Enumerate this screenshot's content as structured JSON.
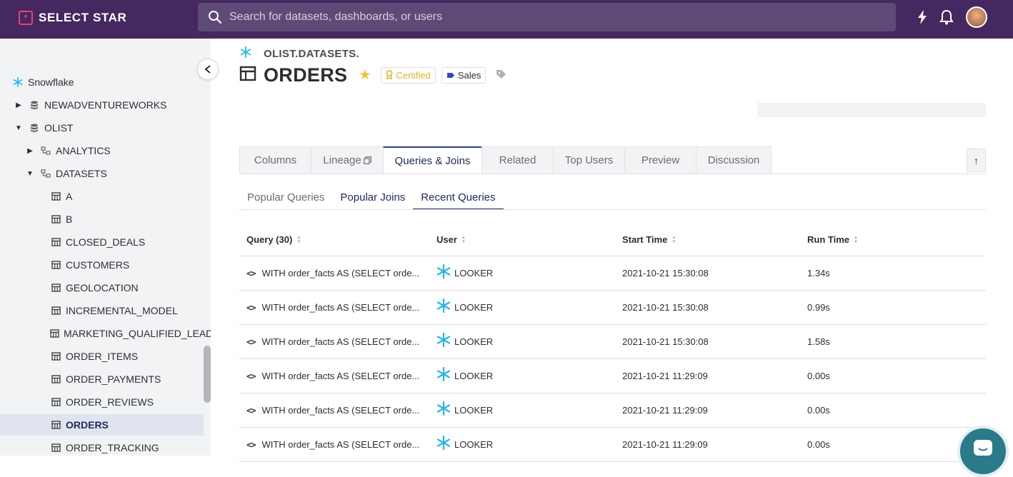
{
  "app": {
    "name": "SELECT STAR",
    "logo_mark": "*"
  },
  "search": {
    "placeholder": "Search for datasets, dashboards, or users",
    "value": ""
  },
  "top_icons": [
    "lightning-icon",
    "bell-icon",
    "user-avatar"
  ],
  "sidebar": {
    "items": [
      {
        "label": "Snowflake",
        "icon": "snowflake-icon",
        "level": 0,
        "caret": ""
      },
      {
        "label": "NEWADVENTUREWORKS",
        "icon": "database-icon",
        "level": 1,
        "caret": "right"
      },
      {
        "label": "OLIST",
        "icon": "database-icon",
        "level": 1,
        "caret": "down"
      },
      {
        "label": "ANALYTICS",
        "icon": "schema-icon",
        "level": 2,
        "caret": "right"
      },
      {
        "label": "DATASETS",
        "icon": "schema-icon",
        "level": 2,
        "caret": "down"
      },
      {
        "label": "A",
        "icon": "table-icon",
        "level": 3
      },
      {
        "label": "B",
        "icon": "table-icon",
        "level": 3
      },
      {
        "label": "CLOSED_DEALS",
        "icon": "table-icon",
        "level": 3
      },
      {
        "label": "CUSTOMERS",
        "icon": "table-icon",
        "level": 3
      },
      {
        "label": "GEOLOCATION",
        "icon": "table-icon",
        "level": 3
      },
      {
        "label": "INCREMENTAL_MODEL",
        "icon": "table-icon",
        "level": 3
      },
      {
        "label": "MARKETING_QUALIFIED_LEADS",
        "icon": "table-icon",
        "level": 3
      },
      {
        "label": "ORDER_ITEMS",
        "icon": "table-icon",
        "level": 3
      },
      {
        "label": "ORDER_PAYMENTS",
        "icon": "table-icon",
        "level": 3
      },
      {
        "label": "ORDER_REVIEWS",
        "icon": "table-icon",
        "level": 3
      },
      {
        "label": "ORDERS",
        "icon": "table-icon",
        "level": 3,
        "selected": true
      },
      {
        "label": "ORDER_TRACKING",
        "icon": "table-icon",
        "level": 3
      }
    ]
  },
  "header": {
    "breadcrumb": "OLIST.DATASETS.",
    "title": "ORDERS",
    "certified_label": "Certified",
    "tag_label": "Sales"
  },
  "tabs": [
    "Columns",
    "Lineage",
    "Queries & Joins",
    "Related",
    "Top Users",
    "Preview",
    "Discussion"
  ],
  "active_tab": "Queries & Joins",
  "subtabs": [
    "Popular Queries",
    "Popular Joins",
    "Recent Queries"
  ],
  "active_subtab": "Recent Queries",
  "table": {
    "columns": [
      "Query (30)",
      "User",
      "Start Time",
      "Run Time"
    ],
    "rows": [
      {
        "query": "WITH order_facts AS (SELECT orde...",
        "user": "LOOKER",
        "start_time": "2021-10-21 15:30:08",
        "run_time": "1.34s"
      },
      {
        "query": "WITH order_facts AS (SELECT orde...",
        "user": "LOOKER",
        "start_time": "2021-10-21 15:30:08",
        "run_time": "0.99s"
      },
      {
        "query": "WITH order_facts AS (SELECT orde...",
        "user": "LOOKER",
        "start_time": "2021-10-21 15:30:08",
        "run_time": "1.58s"
      },
      {
        "query": "WITH order_facts AS (SELECT orde...",
        "user": "LOOKER",
        "start_time": "2021-10-21 11:29:09",
        "run_time": "0.00s"
      },
      {
        "query": "WITH order_facts AS (SELECT orde...",
        "user": "LOOKER",
        "start_time": "2021-10-21 11:29:09",
        "run_time": "0.00s"
      },
      {
        "query": "WITH order_facts AS (SELECT orde...",
        "user": "LOOKER",
        "start_time": "2021-10-21 11:29:09",
        "run_time": "0.00s"
      }
    ]
  },
  "colors": {
    "topbar": "#44285f",
    "accent": "#1d2a5b",
    "snowflake": "#29b5e8",
    "star": "#f2c12e",
    "brand_pink": "#e9407d"
  }
}
